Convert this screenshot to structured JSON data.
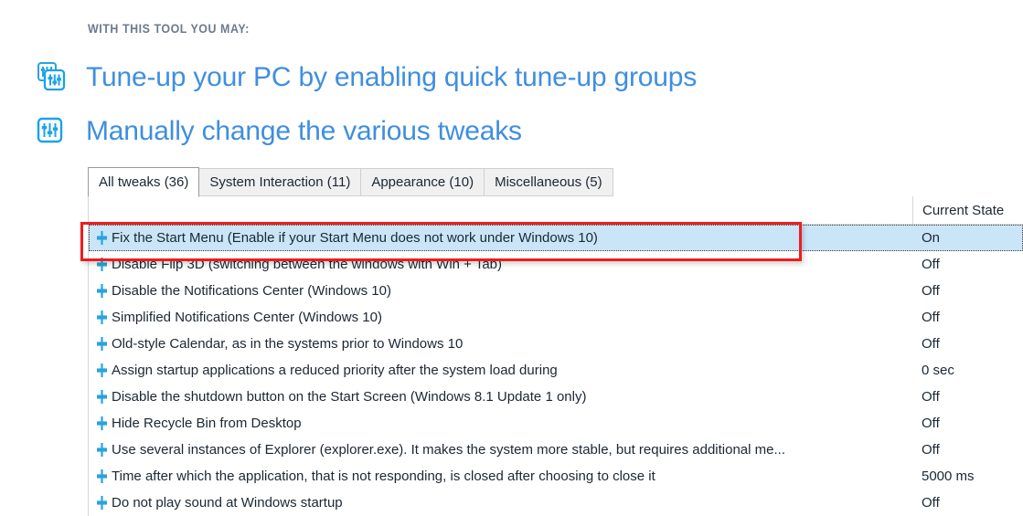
{
  "intro": {
    "kicker": "WITH THIS TOOL YOU MAY:",
    "features": [
      {
        "icon": "sliders-stacked-icon",
        "label": "Tune-up your PC by enabling quick tune-up groups"
      },
      {
        "icon": "sliders-icon",
        "label": "Manually change the various tweaks"
      }
    ]
  },
  "tabs": [
    {
      "label": "All tweaks (36)",
      "active": true
    },
    {
      "label": "System Interaction (11)",
      "active": false
    },
    {
      "label": "Appearance (10)",
      "active": false
    },
    {
      "label": "Miscellaneous (5)",
      "active": false
    }
  ],
  "grid": {
    "columns": {
      "name": "",
      "state": "Current State"
    },
    "rows": [
      {
        "icon": "tweak-slider-icon",
        "label": "Fix the Start Menu (Enable if your Start Menu does not work under Windows 10)",
        "state": "On",
        "selected": true
      },
      {
        "icon": "tweak-slider-icon",
        "label": "Disable Flip 3D (switching between the windows with Win + Tab)",
        "state": "Off",
        "selected": false
      },
      {
        "icon": "tweak-slider-icon",
        "label": "Disable the Notifications Center (Windows 10)",
        "state": "Off",
        "selected": false
      },
      {
        "icon": "tweak-slider-icon",
        "label": "Simplified Notifications Center (Windows 10)",
        "state": "Off",
        "selected": false
      },
      {
        "icon": "tweak-slider-icon",
        "label": "Old-style Calendar, as in the systems prior to Windows 10",
        "state": "Off",
        "selected": false
      },
      {
        "icon": "tweak-slider-icon",
        "label": "Assign startup applications a reduced priority after the system load during",
        "state": "0 sec",
        "selected": false
      },
      {
        "icon": "tweak-slider-icon",
        "label": "Disable the shutdown button on the Start Screen (Windows 8.1 Update 1 only)",
        "state": "Off",
        "selected": false
      },
      {
        "icon": "tweak-slider-icon",
        "label": "Hide Recycle Bin from Desktop",
        "state": "Off",
        "selected": false
      },
      {
        "icon": "tweak-slider-icon",
        "label": "Use several instances of Explorer (explorer.exe). It makes the system more stable, but requires additional me...",
        "state": "Off",
        "selected": false
      },
      {
        "icon": "tweak-slider-icon",
        "label": "Time after which the application, that is not responding, is closed after choosing to close it",
        "state": "5000 ms",
        "selected": false
      },
      {
        "icon": "tweak-slider-icon",
        "label": "Do not play sound at Windows startup",
        "state": "Off",
        "selected": false
      }
    ]
  },
  "annotation": {
    "name": "red-highlight-box",
    "color": "#ee1d1d",
    "targets_row_index": 0
  },
  "colors": {
    "accent_blue": "#3f8ee0",
    "icon_blue": "#29a3e0",
    "selection_blue": "#cbe5f8",
    "kicker_gray": "#6b7a90",
    "text_dark": "#1b2733",
    "annotation_red": "#ee1d1d"
  }
}
